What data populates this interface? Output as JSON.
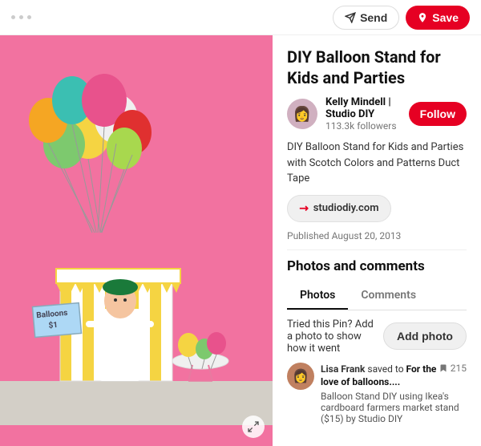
{
  "topbar": {
    "dots": 3,
    "send_label": "Send",
    "save_label": "Save"
  },
  "pin": {
    "title": "DIY Balloon Stand for Kids and Parties",
    "author": {
      "name": "Kelly Mindell | Studio DIY",
      "followers": "113.3k followers",
      "avatar_emoji": "👩"
    },
    "follow_label": "Follow",
    "description": "DIY Balloon Stand for Kids and Parties with Scotch Colors and Patterns Duct Tape",
    "website": "studiodiy.com",
    "published": "Published August 20, 2013",
    "sections": {
      "title": "Photos and comments",
      "tabs": [
        {
          "label": "Photos",
          "active": true
        },
        {
          "label": "Comments",
          "active": false
        }
      ]
    },
    "add_photo": {
      "prompt": "Tried this Pin? Add a photo to show how it went",
      "button_label": "Add photo"
    },
    "comment": {
      "saver": "Lisa Frank",
      "action": "saved to",
      "board": "For the love of balloons....",
      "save_count": "215",
      "text": "Balloon Stand DIY using Ikea's cardboard farmers market stand ($15) by Studio DIY",
      "avatar_emoji": "👩"
    }
  },
  "stand_sign": {
    "line1": "Balloons",
    "line2": "$1"
  }
}
